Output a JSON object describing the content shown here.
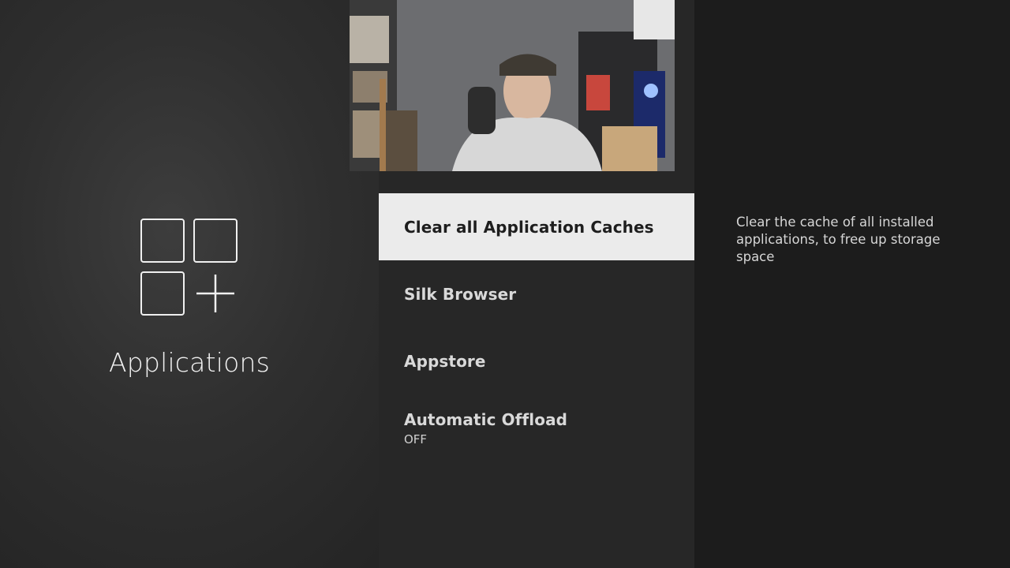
{
  "category": {
    "title": "Applications",
    "icon": "apps-grid-plus-icon"
  },
  "menu": {
    "items": [
      {
        "label": "Clear all Application Caches",
        "sub": "",
        "selected": true
      },
      {
        "label": "Silk Browser",
        "sub": "",
        "selected": false
      },
      {
        "label": "Appstore",
        "sub": "",
        "selected": false
      },
      {
        "label": "Automatic Offload",
        "sub": "OFF",
        "selected": false
      }
    ]
  },
  "description": {
    "text": "Clear the cache of all installed applications, to free up storage space"
  },
  "webcam": {
    "icon": "webcam-overlay"
  },
  "colors": {
    "selected_bg": "#ebebeb",
    "center_bg": "#272727",
    "right_bg": "#1c1c1c",
    "text": "#d9d9d9"
  }
}
